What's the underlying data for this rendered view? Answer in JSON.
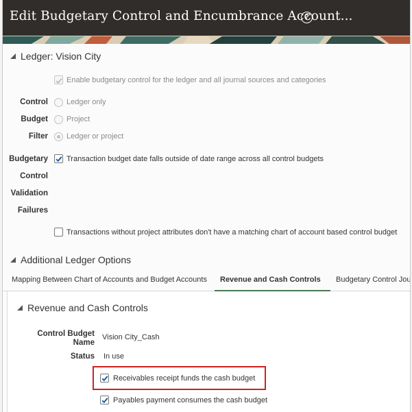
{
  "header": {
    "title": "Edit Budgetary Control and Encumbrance Account...",
    "help_icon": "question-circle-icon"
  },
  "ledger_section": {
    "heading": "Ledger: Vision City",
    "enable_checkbox_label": "Enable budgetary control for the ledger and all journal sources and categories",
    "enable_checked": true,
    "control_budget_filter": {
      "labels": [
        "Control",
        "Budget",
        "Filter"
      ],
      "options": [
        "Ledger only",
        "Project",
        "Ledger or project"
      ],
      "selected": "Ledger or project"
    },
    "validation_failures": {
      "labels": [
        "Budgetary",
        "Control",
        "Validation",
        "Failures"
      ],
      "option1_label": "Transaction budget date falls outside of date range across all control budgets",
      "option1_checked": true,
      "option2_label": "Transactions without project attributes don't have a matching chart of account based control budget",
      "option2_checked": false
    }
  },
  "additional_section": {
    "heading": "Additional Ledger Options",
    "tabs": [
      {
        "label": "Mapping Between Chart of Accounts and Budget Accounts"
      },
      {
        "label": "Revenue and Cash Controls"
      },
      {
        "label": "Budgetary Control Jou"
      }
    ],
    "active_tab": "Revenue and Cash Controls"
  },
  "revenue_cash": {
    "heading": "Revenue and Cash Controls",
    "control_budget_name_label_1": "Control Budget",
    "control_budget_name_label_2": "Name",
    "control_budget_name": "Vision City_Cash",
    "status_label": "Status",
    "status_value": "In use",
    "receivables_label": "Receivables receipt funds the cash budget",
    "receivables_checked": true,
    "payables_label": "Payables payment consumes the cash budget",
    "payables_checked": true
  },
  "colors": {
    "titlebar": "#312d2a",
    "checkbox_blue": "#1f5fa8",
    "highlight_red": "#d11f1f",
    "tab_underline": "#4b7a55"
  }
}
